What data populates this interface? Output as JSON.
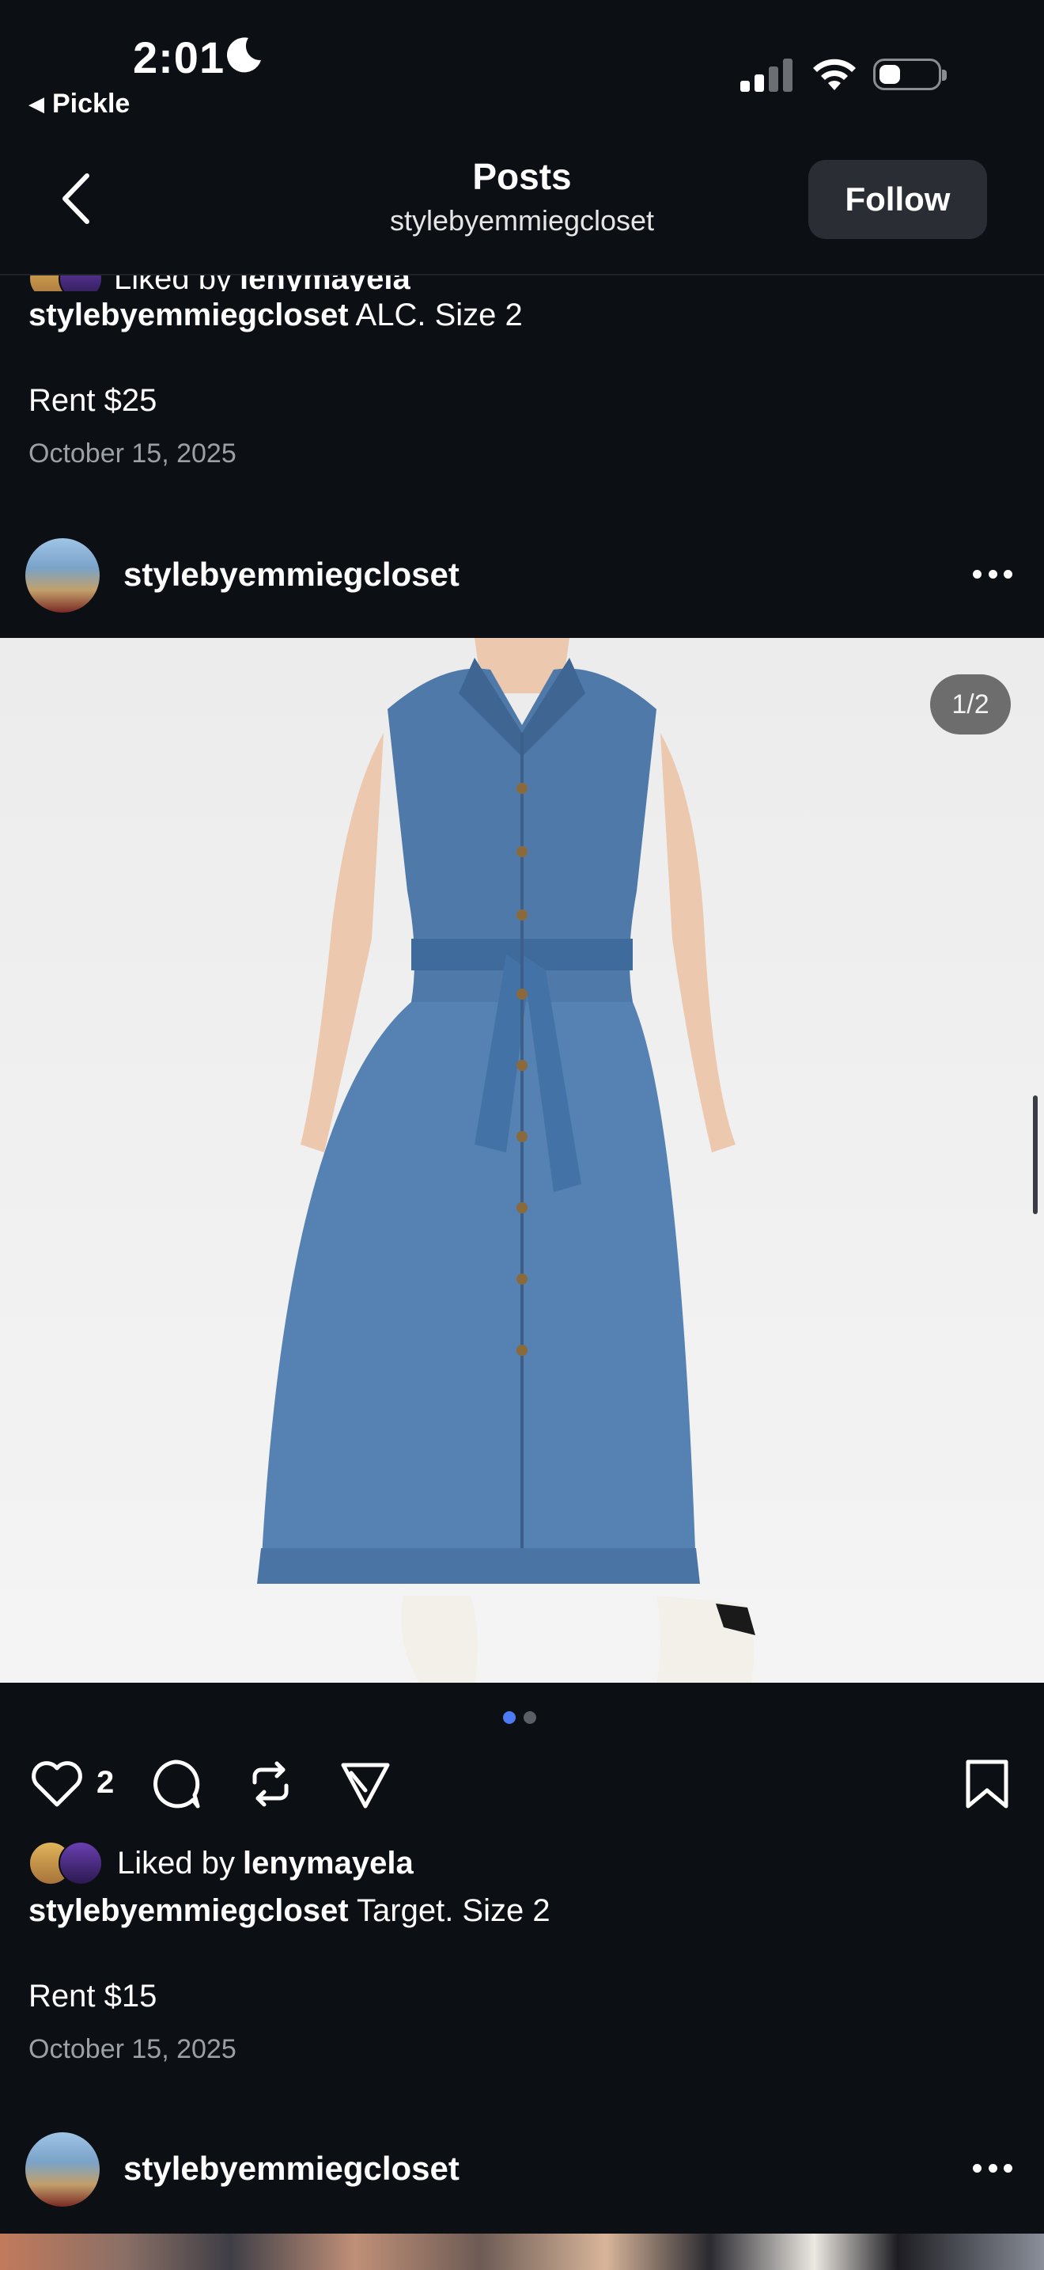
{
  "status_bar": {
    "time": "2:01",
    "back_app": "Pickle"
  },
  "header": {
    "title": "Posts",
    "subtitle": "stylebyemmiegcloset",
    "follow_label": "Follow"
  },
  "previous_post": {
    "liked_by_prefix": "Liked by",
    "liked_by_user": "lenymayela",
    "caption_user": "stylebyemmiegcloset",
    "caption_text": "ALC. Size 2",
    "rent": "Rent $25",
    "date": "October 15, 2025"
  },
  "post": {
    "username": "stylebyemmiegcloset",
    "image_counter": "1/2",
    "image_description_icon": "denim-dress-photo",
    "carousel_dots": 2,
    "carousel_active": 0,
    "like_count": "2",
    "liked_by_prefix": "Liked by",
    "liked_by_user": "lenymayela",
    "caption_user": "stylebyemmiegcloset",
    "caption_text": "Target. Size 2",
    "rent": "Rent $15",
    "date": "October 15, 2025"
  },
  "next_post": {
    "username": "stylebyemmiegcloset"
  },
  "colors": {
    "background": "#0c0f14",
    "button_bg": "#2a2d33",
    "active_dot": "#4c7bf3",
    "muted_text": "#9aa0a6"
  }
}
